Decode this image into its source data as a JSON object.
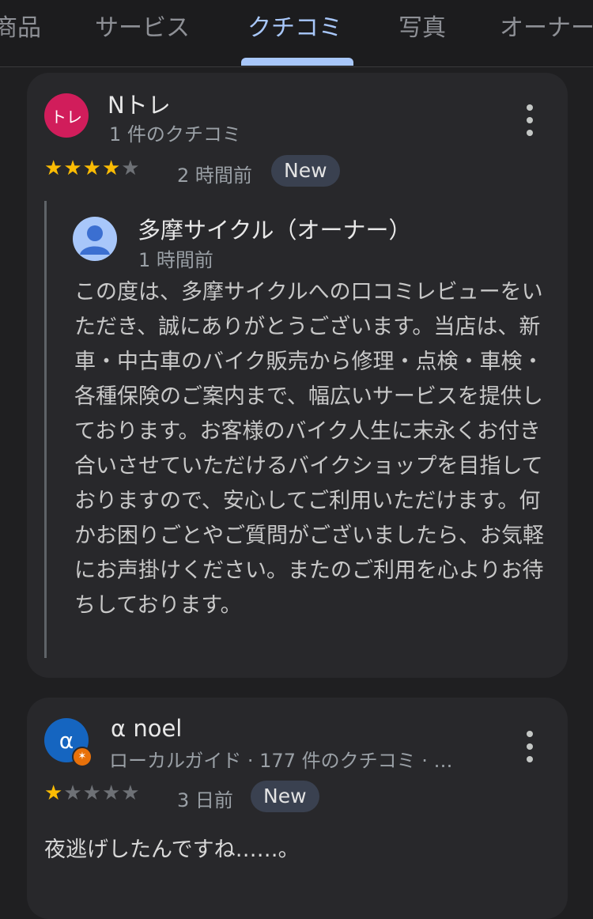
{
  "tabs": [
    {
      "label": "商品",
      "active": false
    },
    {
      "label": "サービス",
      "active": false
    },
    {
      "label": "クチコミ",
      "active": true
    },
    {
      "label": "写真",
      "active": false
    },
    {
      "label": "オーナー",
      "active": false
    }
  ],
  "colors": {
    "accent": "#a8c7fa",
    "star": "#fbbc04",
    "avatar1": "#d11d5b",
    "avatar2": "#1565c0"
  },
  "reviews": [
    {
      "avatar_text": "トレ",
      "name": "Nトレ",
      "meta": "1 件のクチコミ",
      "rating": 4,
      "time": "2 時間前",
      "badge": "New",
      "owner_reply": {
        "name": "多摩サイクル（オーナー）",
        "time": "1 時間前",
        "text": "この度は、多摩サイクルへの口コミレビューをいただき、誠にありがとうございます。当店は、新車・中古車のバイク販売から修理・点検・車検・各種保険のご案内まで、幅広いサービスを提供しております。お客様のバイク人生に末永くお付き合いさせていただけるバイクショップを目指しておりますので、安心してご利用いただけます。何かお困りごとやご質問がございましたら、お気軽にお声掛けください。またのご利用を心よりお待ちしております。"
      }
    },
    {
      "avatar_text": "α",
      "name": "α noel",
      "meta": "ローカルガイド · 177 件のクチコミ · …",
      "rating": 1,
      "time": "3 日前",
      "badge": "New",
      "text": "夜逃げしたんですね……。"
    }
  ]
}
